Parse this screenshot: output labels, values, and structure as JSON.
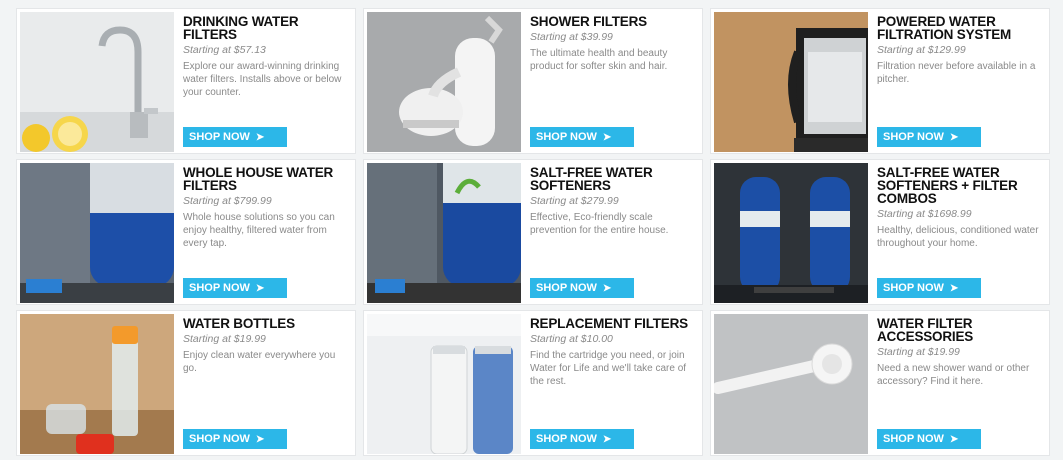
{
  "products": [
    {
      "title": "Drinking Water Filters",
      "price": "Starting at $57.13",
      "desc": "Explore our award-winning drinking water filters. Installs above or below your counter.",
      "cta": "SHOP NOW"
    },
    {
      "title": "Shower Filters",
      "price": "Starting at $39.99",
      "desc": "The ultimate health and beauty product for softer skin and hair.",
      "cta": "SHOP NOW"
    },
    {
      "title": "Powered Water Filtration System",
      "price": "Starting at $129.99",
      "desc": "Filtration never before available in a pitcher.",
      "cta": "SHOP NOW"
    },
    {
      "title": "Whole House Water Filters",
      "price": "Starting at $799.99",
      "desc": "Whole house solutions so you can enjoy healthy, filtered water from every tap.",
      "cta": "SHOP NOW"
    },
    {
      "title": "Salt-Free Water Softeners",
      "price": "Starting at $279.99",
      "desc": "Effective, Eco-friendly scale prevention for the entire house.",
      "cta": "SHOP NOW"
    },
    {
      "title": "Salt-Free Water Softeners + Filter Combos",
      "price": "Starting at $1698.99",
      "desc": "Healthy, delicious, conditioned water throughout your home.",
      "cta": "SHOP NOW"
    },
    {
      "title": "Water Bottles",
      "price": "Starting at $19.99",
      "desc": "Enjoy clean water everywhere you go.",
      "cta": "SHOP NOW"
    },
    {
      "title": "Replacement Filters",
      "price": "Starting at $10.00",
      "desc": "Find the cartridge you need, or join Water for Life and we'll take care of the rest.",
      "cta": "SHOP NOW"
    },
    {
      "title": "Water Filter Accessories",
      "price": "Starting at $19.99",
      "desc": "Need a new shower wand or other accessory? Find it here.",
      "cta": "SHOP NOW"
    }
  ],
  "colors": {
    "accent": "#2cb7e8",
    "title": "#111111",
    "muted": "#8a8a8a"
  }
}
